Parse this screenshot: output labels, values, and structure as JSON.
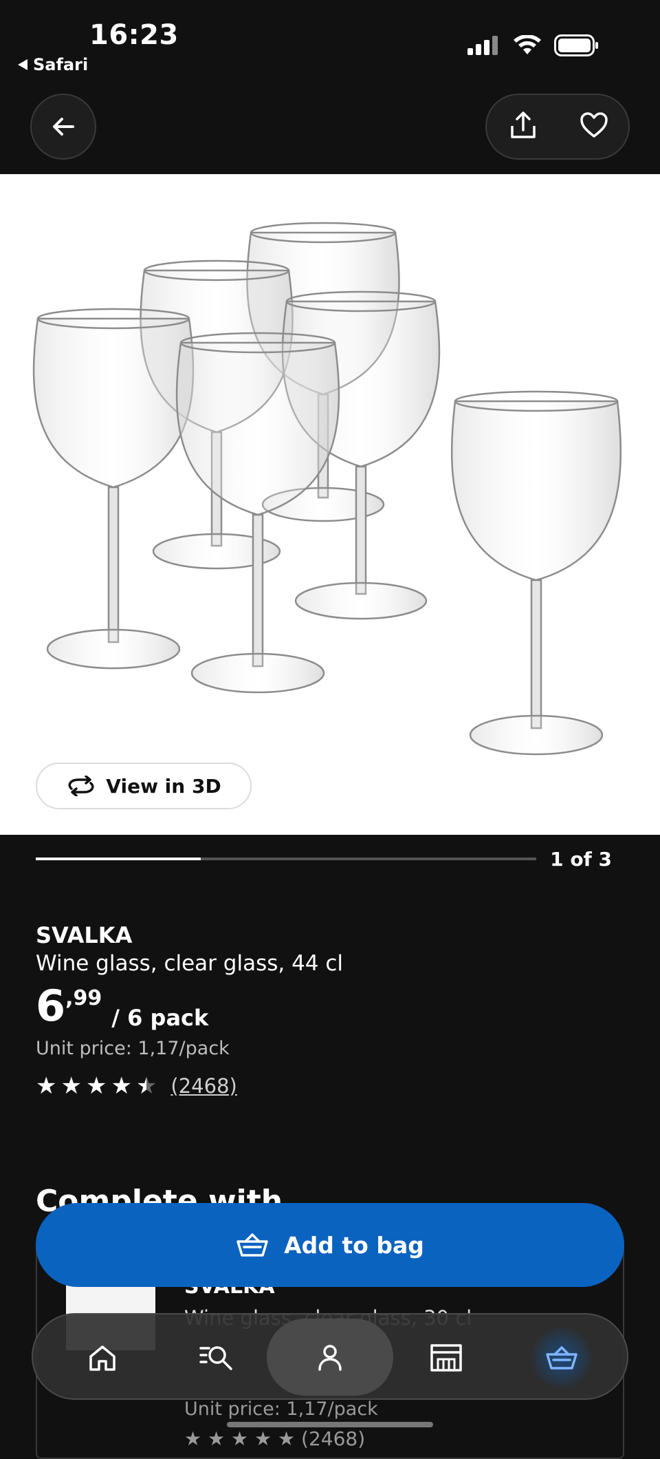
{
  "status_bar": {
    "time": "16:23",
    "back_app": "Safari",
    "icons": [
      "signal-icon",
      "wifi-icon",
      "battery-icon"
    ]
  },
  "nav": {
    "back_icon": "arrow-left-icon",
    "share_icon": "share-icon",
    "favourite_icon": "heart-icon"
  },
  "gallery": {
    "view_3d_label": "View in 3D",
    "page_indicator": "1 of 3",
    "progress_fraction": 0.33
  },
  "product": {
    "brand": "SVALKA",
    "description": "Wine glass, clear glass, 44 cl",
    "price_integer": "6",
    "price_decimal": ",99",
    "price_unit": "/ 6 pack",
    "unit_price": "Unit price: 1,17/pack",
    "rating": 4.5,
    "review_count": "(2468)"
  },
  "complete_with": {
    "title": "Complete with",
    "item": {
      "brand": "SVALKA",
      "description": "Wine glass, clear glass, 30 cl",
      "unit_price": "Unit price: 1,17/pack",
      "review_count": "(2468)"
    }
  },
  "actions": {
    "add_to_bag_label": "Add to bag"
  },
  "tab_bar": {
    "items": [
      "home-icon",
      "search-list-icon",
      "profile-icon",
      "store-icon",
      "basket-icon"
    ],
    "active": "profile-icon"
  },
  "colors": {
    "background": "#111111",
    "accent_blue": "#0b63c0"
  }
}
